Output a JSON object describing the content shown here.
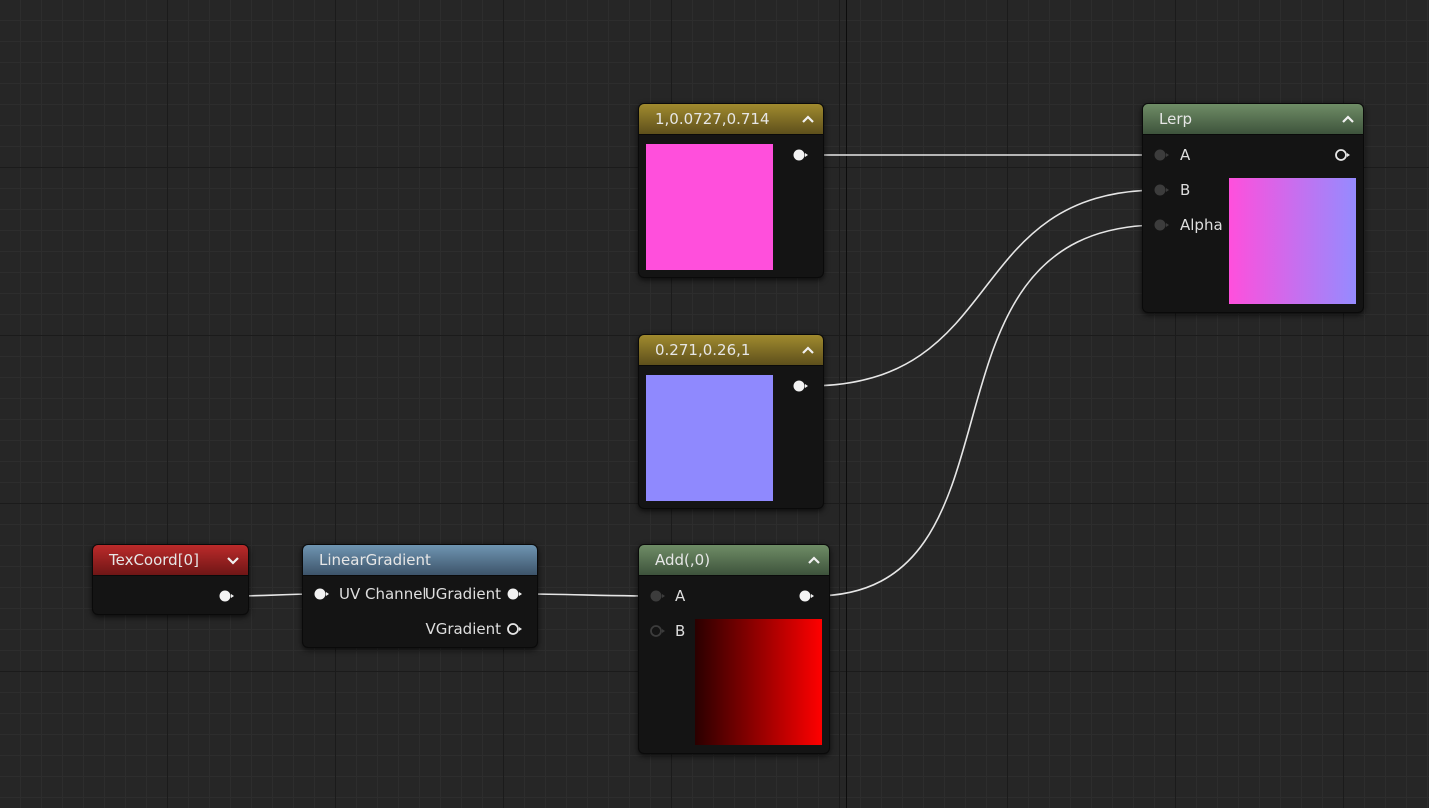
{
  "graph": {
    "nodes": {
      "constant_pink": {
        "title": "1,0.0727,0.714",
        "swatch_color": "#ff4fdc"
      },
      "constant_blue": {
        "title": "0.271,0.26,1",
        "swatch_color": "#8f89fe"
      },
      "lerp": {
        "title": "Lerp",
        "input_a": "A",
        "input_b": "B",
        "input_alpha": "Alpha",
        "preview_from": "#ff4fdc",
        "preview_to": "#958bff"
      },
      "add": {
        "title": "Add(,0)",
        "input_a": "A",
        "input_b": "B",
        "preview_from": "#2a0000",
        "preview_to": "#ff0000"
      },
      "texcoord": {
        "title": "TexCoord[0]"
      },
      "linear_gradient": {
        "title": "LinearGradient",
        "input_uv": "UV Channel",
        "output_u": "UGradient",
        "output_v": "VGradient"
      }
    }
  }
}
